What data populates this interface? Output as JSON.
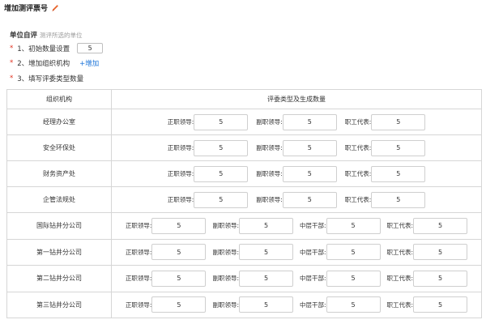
{
  "title": "增加测评票号",
  "unit": {
    "label": "单位自评",
    "hint": "测评所选的单位"
  },
  "steps": [
    {
      "star": "*",
      "label": "1、初始数量设置",
      "value": "5"
    },
    {
      "star": "*",
      "label": "2、增加组织机构",
      "link": "+增加"
    },
    {
      "star": "*",
      "label": "3、填写评委类型数量"
    }
  ],
  "table": {
    "headers": [
      "组织机构",
      "评委类型及生成数量"
    ],
    "rows": [
      {
        "org": "经理办公室",
        "fields": [
          {
            "label": "正职领导:",
            "value": "5"
          },
          {
            "label": "副职领导:",
            "value": "5"
          },
          {
            "label": "职工代表:",
            "value": "5"
          }
        ]
      },
      {
        "org": "安全环保处",
        "fields": [
          {
            "label": "正职领导:",
            "value": "5"
          },
          {
            "label": "副职领导:",
            "value": "5"
          },
          {
            "label": "职工代表:",
            "value": "5"
          }
        ]
      },
      {
        "org": "财务资产处",
        "fields": [
          {
            "label": "正职领导:",
            "value": "5"
          },
          {
            "label": "副职领导:",
            "value": "5"
          },
          {
            "label": "职工代表:",
            "value": "5"
          }
        ]
      },
      {
        "org": "企管法规处",
        "fields": [
          {
            "label": "正职领导:",
            "value": "5"
          },
          {
            "label": "副职领导:",
            "value": "5"
          },
          {
            "label": "职工代表:",
            "value": "5"
          }
        ]
      },
      {
        "org": "国际钻井分公司",
        "fields": [
          {
            "label": "正职领导:",
            "value": "5"
          },
          {
            "label": "副职领导:",
            "value": "5"
          },
          {
            "label": "中层干部:",
            "value": "5"
          },
          {
            "label": "职工代表:",
            "value": "5"
          }
        ]
      },
      {
        "org": "第一钻井分公司",
        "fields": [
          {
            "label": "正职领导:",
            "value": "5"
          },
          {
            "label": "副职领导:",
            "value": "5"
          },
          {
            "label": "中层干部:",
            "value": "5"
          },
          {
            "label": "职工代表:",
            "value": "5"
          }
        ]
      },
      {
        "org": "第二钻井分公司",
        "fields": [
          {
            "label": "正职领导:",
            "value": "5"
          },
          {
            "label": "副职领导:",
            "value": "5"
          },
          {
            "label": "中层干部:",
            "value": "5"
          },
          {
            "label": "职工代表:",
            "value": "5"
          }
        ]
      },
      {
        "org": "第三钻井分公司",
        "fields": [
          {
            "label": "正职领导:",
            "value": "5"
          },
          {
            "label": "副职领导:",
            "value": "5"
          },
          {
            "label": "中层干部:",
            "value": "5"
          },
          {
            "label": "职工代表:",
            "value": "5"
          }
        ]
      }
    ]
  },
  "colors": {
    "accent": "#1a73d9",
    "required": "#e0301e",
    "edit_icon": "#e8642a"
  },
  "icons": {
    "title_icon": "pencil-icon"
  }
}
